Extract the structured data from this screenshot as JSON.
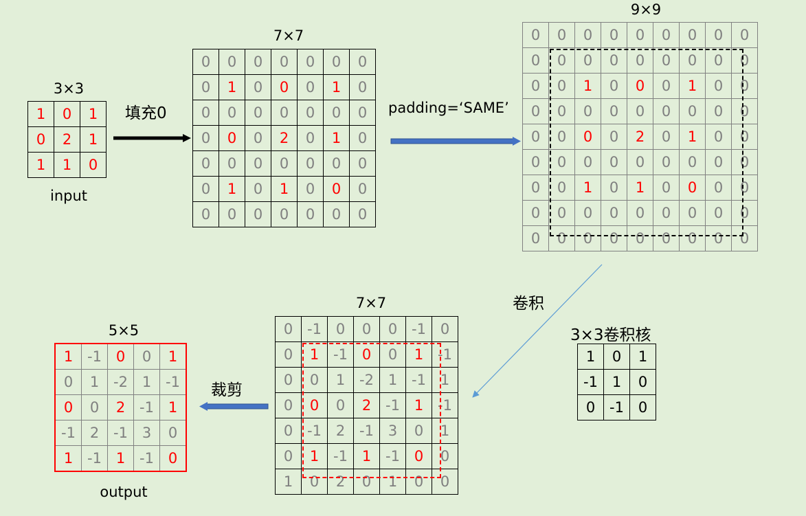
{
  "input": {
    "title": "3×3",
    "caption": "input",
    "rows": [
      [
        1,
        0,
        1
      ],
      [
        0,
        2,
        1
      ],
      [
        1,
        1,
        0
      ]
    ]
  },
  "step1": {
    "label": "填充0"
  },
  "padded7": {
    "title": "7×7",
    "rows": [
      [
        0,
        0,
        0,
        0,
        0,
        0,
        0
      ],
      [
        0,
        1,
        0,
        0,
        0,
        1,
        0
      ],
      [
        0,
        0,
        0,
        0,
        0,
        0,
        0
      ],
      [
        0,
        0,
        0,
        2,
        0,
        1,
        0
      ],
      [
        0,
        0,
        0,
        0,
        0,
        0,
        0
      ],
      [
        0,
        1,
        0,
        1,
        0,
        0,
        0
      ],
      [
        0,
        0,
        0,
        0,
        0,
        0,
        0
      ]
    ],
    "red": [
      [
        1,
        1
      ],
      [
        1,
        3
      ],
      [
        1,
        5
      ],
      [
        3,
        1
      ],
      [
        3,
        3
      ],
      [
        3,
        5
      ],
      [
        5,
        1
      ],
      [
        5,
        3
      ],
      [
        5,
        5
      ]
    ]
  },
  "step2": {
    "label": "padding=‘SAME’"
  },
  "padded9": {
    "title": "9×9",
    "rows": [
      [
        0,
        0,
        0,
        0,
        0,
        0,
        0,
        0,
        0
      ],
      [
        0,
        0,
        0,
        0,
        0,
        0,
        0,
        0,
        0
      ],
      [
        0,
        0,
        1,
        0,
        0,
        0,
        1,
        0,
        0
      ],
      [
        0,
        0,
        0,
        0,
        0,
        0,
        0,
        0,
        0
      ],
      [
        0,
        0,
        0,
        0,
        2,
        0,
        1,
        0,
        0
      ],
      [
        0,
        0,
        0,
        0,
        0,
        0,
        0,
        0,
        0
      ],
      [
        0,
        0,
        1,
        0,
        1,
        0,
        0,
        0,
        0
      ],
      [
        0,
        0,
        0,
        0,
        0,
        0,
        0,
        0,
        0
      ],
      [
        0,
        0,
        0,
        0,
        0,
        0,
        0,
        0,
        0
      ]
    ],
    "red": [
      [
        2,
        2
      ],
      [
        2,
        4
      ],
      [
        2,
        6
      ],
      [
        4,
        2
      ],
      [
        4,
        4
      ],
      [
        4,
        6
      ],
      [
        6,
        2
      ],
      [
        6,
        4
      ],
      [
        6,
        6
      ]
    ]
  },
  "step3": {
    "label": "卷积"
  },
  "kernel": {
    "title": "3×3卷积核",
    "rows": [
      [
        1,
        0,
        1
      ],
      [
        -1,
        1,
        0
      ],
      [
        0,
        -1,
        0
      ]
    ]
  },
  "conv7": {
    "title": "7×7",
    "rows": [
      [
        0,
        -1,
        0,
        0,
        0,
        -1,
        0
      ],
      [
        0,
        1,
        -1,
        0,
        0,
        1,
        -1
      ],
      [
        0,
        0,
        1,
        -2,
        1,
        -1,
        1
      ],
      [
        0,
        0,
        0,
        2,
        -1,
        1,
        -1
      ],
      [
        0,
        -1,
        2,
        -1,
        3,
        0,
        1
      ],
      [
        0,
        1,
        -1,
        1,
        -1,
        0,
        0
      ],
      [
        1,
        0,
        2,
        0,
        1,
        0,
        0
      ]
    ],
    "red": [
      [
        1,
        1
      ],
      [
        1,
        3
      ],
      [
        1,
        5
      ],
      [
        3,
        1
      ],
      [
        3,
        3
      ],
      [
        3,
        5
      ],
      [
        5,
        1
      ],
      [
        5,
        3
      ],
      [
        5,
        5
      ]
    ]
  },
  "step4": {
    "label": "裁剪"
  },
  "output": {
    "title": "5×5",
    "caption": "output",
    "rows": [
      [
        1,
        -1,
        0,
        0,
        1
      ],
      [
        0,
        1,
        -2,
        1,
        -1
      ],
      [
        0,
        0,
        2,
        -1,
        1
      ],
      [
        -1,
        2,
        -1,
        3,
        0
      ],
      [
        1,
        -1,
        1,
        -1,
        0
      ]
    ],
    "red": [
      [
        0,
        0
      ],
      [
        0,
        2
      ],
      [
        0,
        4
      ],
      [
        2,
        0
      ],
      [
        2,
        2
      ],
      [
        2,
        4
      ],
      [
        4,
        0
      ],
      [
        4,
        2
      ],
      [
        4,
        4
      ]
    ]
  },
  "colors": {
    "background": "#e2efd9",
    "highlight": "#ff0000",
    "cell_text": "#7f7f7f",
    "arrow_blue": "#4472c4"
  }
}
